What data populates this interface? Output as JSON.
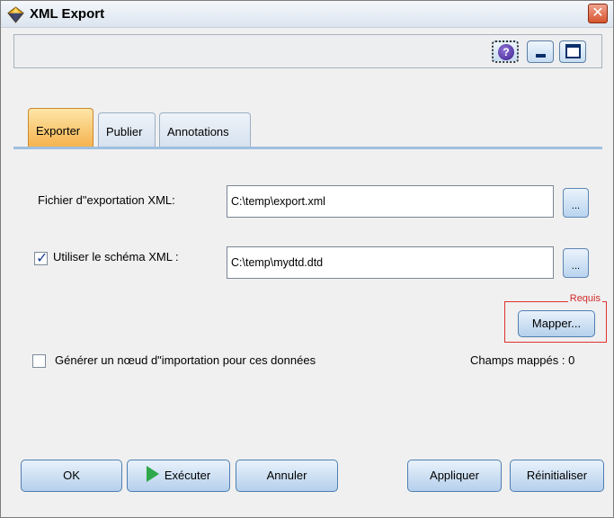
{
  "window": {
    "title": "XML Export",
    "close_glyph": "✕"
  },
  "toolbar": {
    "help_glyph": "?",
    "icons": [
      "help-icon",
      "minimize-icon",
      "maximize-icon"
    ]
  },
  "tabs": [
    {
      "label": "Exporter",
      "active": true
    },
    {
      "label": "Publier",
      "active": false
    },
    {
      "label": "Annotations",
      "active": false
    }
  ],
  "form": {
    "export_file": {
      "label": "Fichier d\"exportation XML:",
      "value": "C:\\temp\\export.xml",
      "browse_label": "..."
    },
    "schema": {
      "checked": true,
      "label": "Utiliser le schéma XML :",
      "value": "C:\\temp\\mydtd.dtd",
      "browse_label": "..."
    },
    "required": {
      "label": "Requis",
      "button": "Mapper..."
    },
    "generate_import": {
      "checked": false,
      "label": "Générer un nœud d\"importation pour ces données"
    },
    "mapped_fields": "Champs mappés : 0"
  },
  "buttons": {
    "ok": "OK",
    "run": "Exécuter",
    "cancel": "Annuler",
    "apply": "Appliquer",
    "reset": "Réinitialiser"
  },
  "colors": {
    "active_tab": "#f6b24d",
    "required": "#d42a2a",
    "run_arrow": "#2ea84a"
  }
}
